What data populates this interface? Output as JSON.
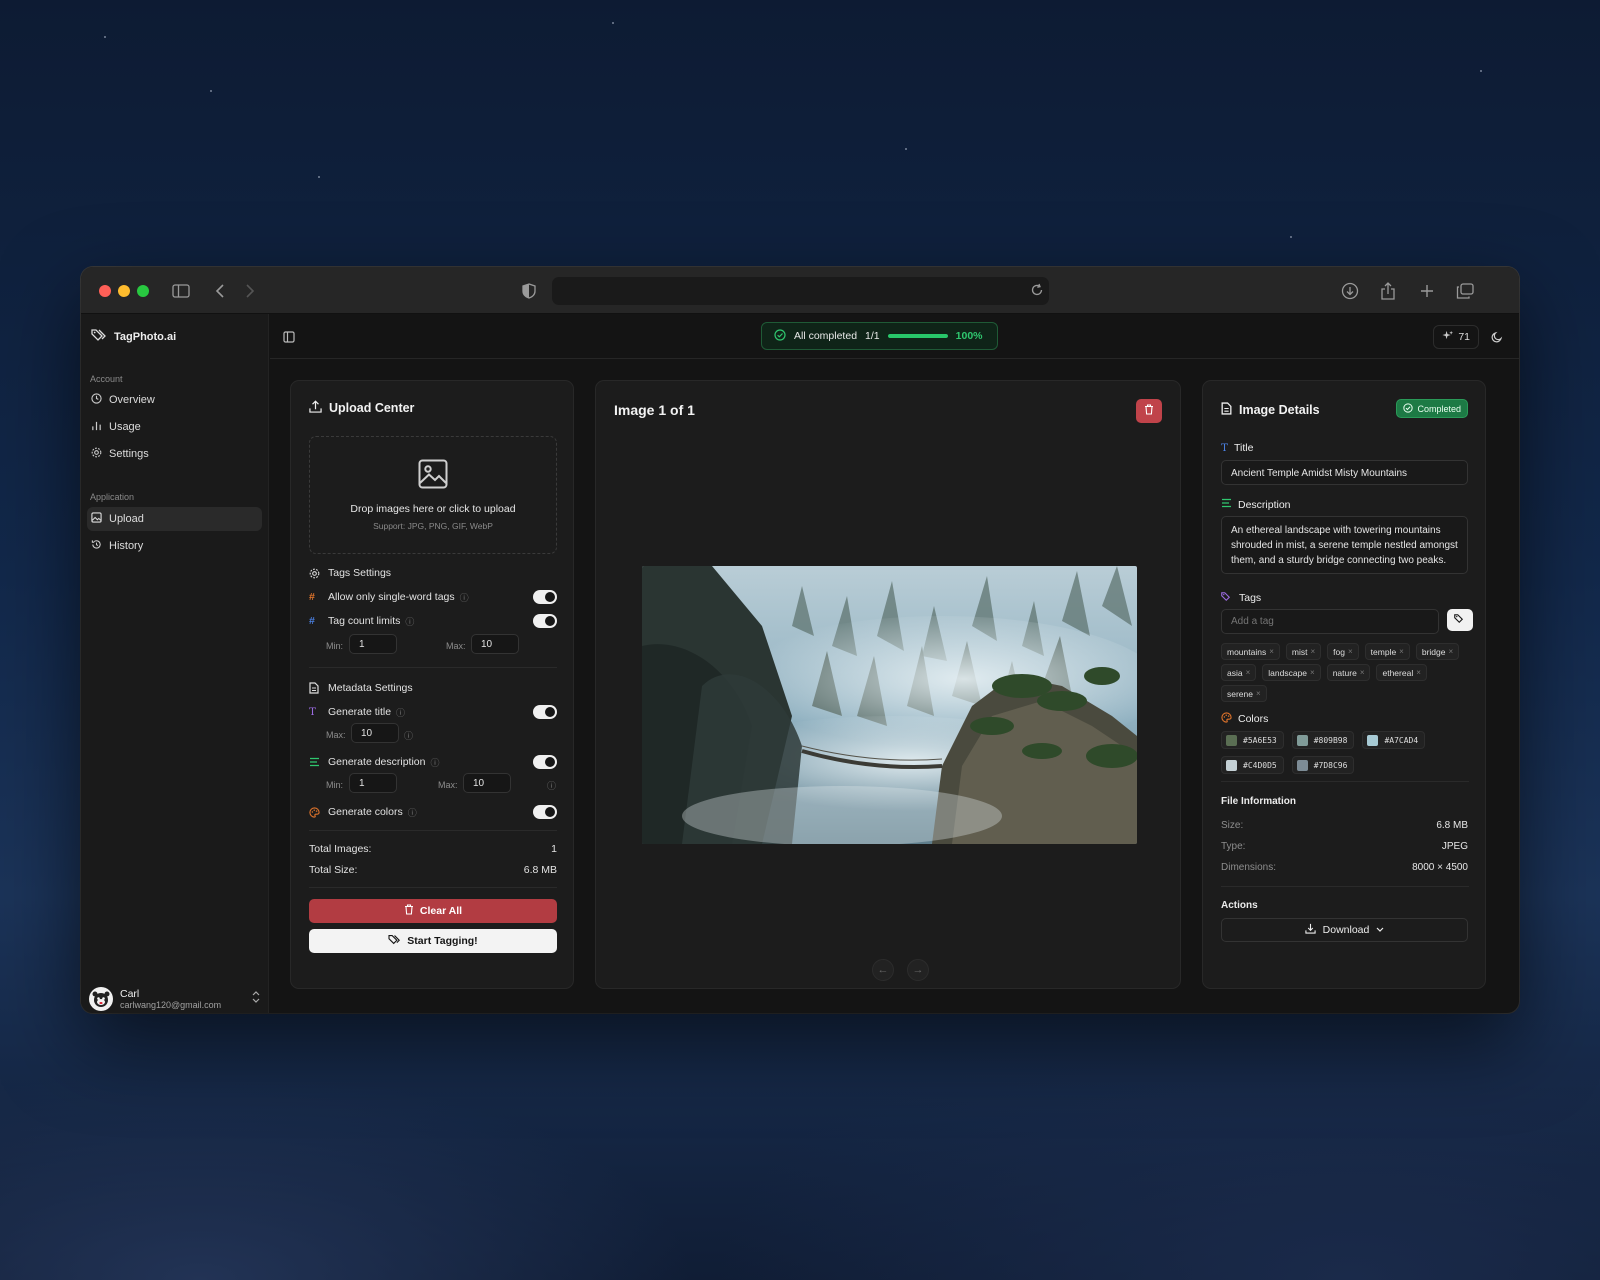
{
  "app": {
    "brand": "TagPhoto.ai",
    "credits": "71"
  },
  "sidebar": {
    "account_label": "Account",
    "application_label": "Application",
    "items": [
      {
        "label": "Overview"
      },
      {
        "label": "Usage"
      },
      {
        "label": "Settings"
      },
      {
        "label": "Upload"
      },
      {
        "label": "History"
      }
    ],
    "user": {
      "name": "Carl",
      "email": "carlwang120@gmail.com"
    }
  },
  "status": {
    "text": "All completed",
    "count": "1/1",
    "percent_label": "100%",
    "progress": 1.0
  },
  "upload_center": {
    "title": "Upload Center",
    "drop_text": "Drop images here or click to upload",
    "support_text": "Support: JPG, PNG, GIF, WebP",
    "tags_settings": {
      "title": "Tags Settings",
      "single_word": "Allow only single-word tags",
      "count_limits": "Tag count limits",
      "min_label": "Min:",
      "max_label": "Max:",
      "min_value": "1",
      "max_value": "10"
    },
    "metadata_settings": {
      "title": "Metadata Settings",
      "gen_title": "Generate title",
      "title_max_label": "Max:",
      "title_max_value": "10",
      "gen_description": "Generate description",
      "desc_min_label": "Min:",
      "desc_min_value": "1",
      "desc_max_label": "Max:",
      "desc_max_value": "10",
      "gen_colors": "Generate colors"
    },
    "stats": {
      "total_images_label": "Total Images:",
      "total_images": "1",
      "total_size_label": "Total Size:",
      "total_size": "6.8 MB"
    },
    "clear_all": "Clear All",
    "start_tagging": "Start Tagging!"
  },
  "viewer": {
    "title": "Image 1 of 1"
  },
  "details": {
    "title": "Image Details",
    "status_badge": "Completed",
    "title_label": "Title",
    "title_value": "Ancient Temple Amidst Misty Mountains",
    "description_label": "Description",
    "description_value": "An ethereal landscape with towering mountains shrouded in mist, a serene temple nestled amongst them, and a sturdy bridge connecting two peaks.",
    "tags_label": "Tags",
    "tag_placeholder": "Add a tag",
    "tags": [
      "mountains",
      "mist",
      "fog",
      "temple",
      "bridge",
      "asia",
      "landscape",
      "nature",
      "ethereal",
      "serene"
    ],
    "colors_label": "Colors",
    "colors": [
      "#5A6E53",
      "#809B98",
      "#A7CAD4",
      "#C4D0D5",
      "#7D8C96"
    ],
    "file_info_label": "File Information",
    "size_label": "Size:",
    "size": "6.8 MB",
    "type_label": "Type:",
    "type": "JPEG",
    "dimensions_label": "Dimensions:",
    "dimensions": "8000 × 4500",
    "actions_label": "Actions",
    "download": "Download"
  }
}
